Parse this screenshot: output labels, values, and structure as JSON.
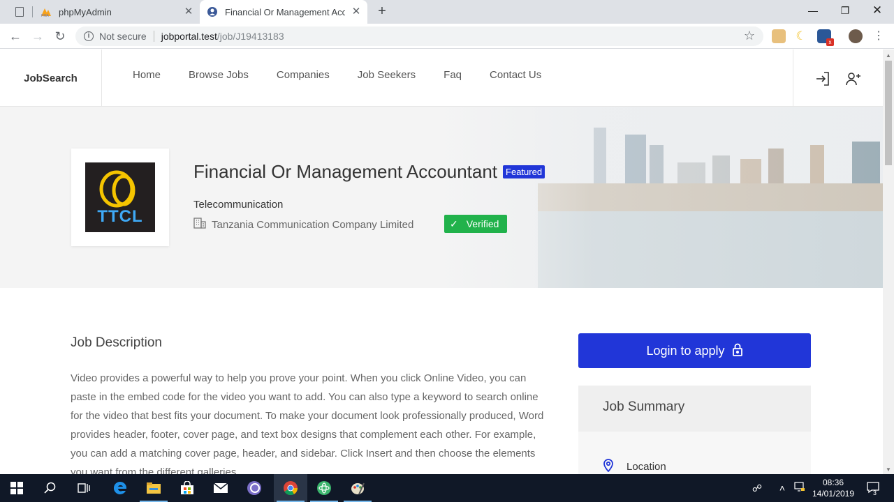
{
  "browser": {
    "tabs": [
      {
        "title": "phpMyAdmin"
      },
      {
        "title": "Financial Or Management Accou"
      }
    ],
    "address": {
      "security": "Not secure",
      "host": "jobportal.test",
      "path": "/job/J19413183"
    }
  },
  "site": {
    "brand": "JobSearch",
    "nav": [
      "Home",
      "Browse Jobs",
      "Companies",
      "Job Seekers",
      "Faq",
      "Contact Us"
    ]
  },
  "job": {
    "title": "Financial Or Management Accountant",
    "featured": "Featured",
    "category": "Telecommunication",
    "company": "Tanzania Communication Company Limited",
    "verified": "Verified",
    "logo_text": "TTCL"
  },
  "description": {
    "heading": "Job Description",
    "text": "Video provides a powerful way to help you prove your point. When you click Online Video, you can paste in the embed code for the video you want to add. You can also type a keyword to search online for the video that best fits your document. To make your document look professionally produced, Word provides header, footer, cover page, and text box designs that complement each other. For example, you can add a matching cover page, header, and sidebar. Click Insert and then choose the elements you want from the different galleries."
  },
  "sidebar": {
    "apply": "Login to apply",
    "summary_heading": "Job Summary",
    "location_label": "Location"
  },
  "taskbar": {
    "time": "08:36",
    "date": "14/01/2019",
    "notifications": "3"
  },
  "colors": {
    "accent": "#2136d8",
    "verified": "#21b24b",
    "taskbar": "#101827"
  }
}
